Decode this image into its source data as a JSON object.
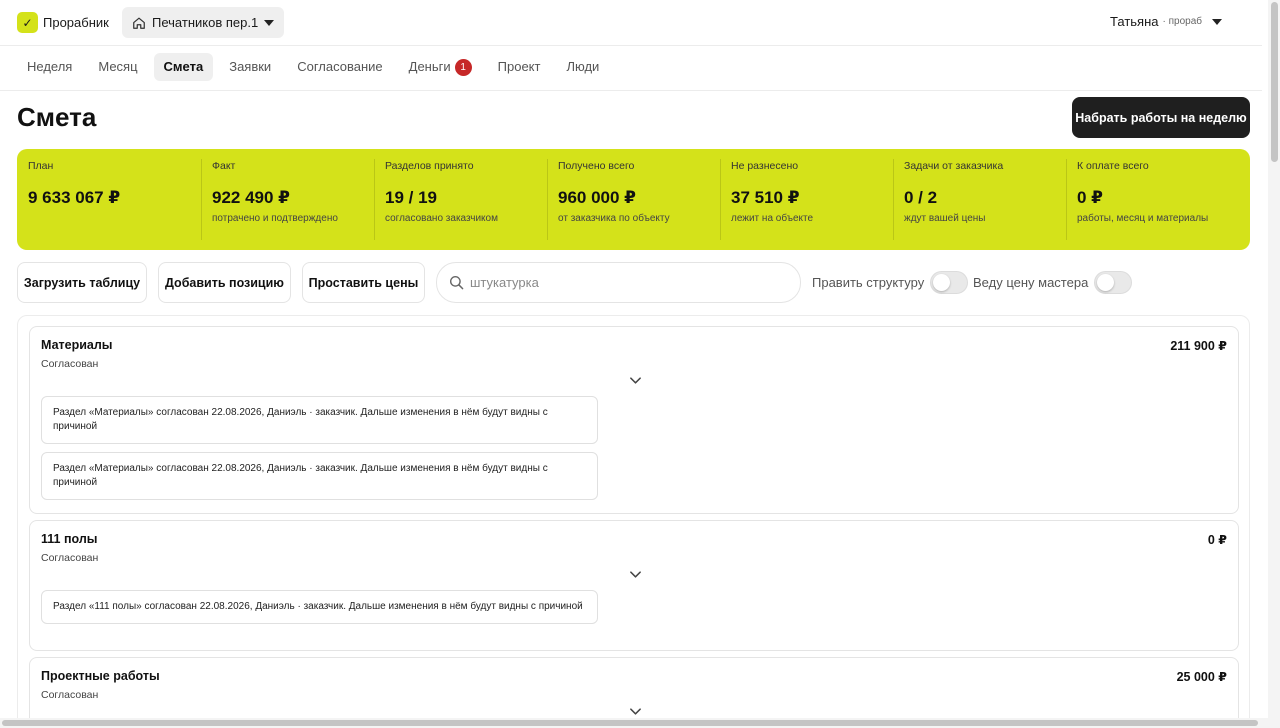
{
  "app": {
    "logo_text": "Прорабник",
    "logo_glyph": "✓"
  },
  "project": {
    "name": "Печатников пер.1"
  },
  "user": {
    "name": "Татьяна",
    "role": "· прораб"
  },
  "tabs": [
    {
      "label": "Неделя"
    },
    {
      "label": "Месяц"
    },
    {
      "label": "Смета"
    },
    {
      "label": "Заявки"
    },
    {
      "label": "Согласование"
    },
    {
      "label": "Деньги",
      "badge": "1"
    },
    {
      "label": "Проект"
    },
    {
      "label": "Люди"
    }
  ],
  "page": {
    "title": "Смета",
    "cta_label": "Набрать работы на неделю"
  },
  "stats": [
    {
      "label": "План",
      "value": "9 633 067 ₽",
      "sub": ""
    },
    {
      "label": "Факт",
      "value": "922 490 ₽",
      "sub": "потрачено и подтверждено"
    },
    {
      "label": "Разделов принято",
      "value": "19 / 19",
      "sub": "согласовано заказчиком"
    },
    {
      "label": "Получено всего",
      "value": "960 000 ₽",
      "sub": "от заказчика по объекту"
    },
    {
      "label": "Не разнесено",
      "value": "37 510 ₽",
      "sub": "лежит на объекте"
    },
    {
      "label": "Задачи от заказчика",
      "value": "0 / 2",
      "sub": "ждут вашей цены"
    },
    {
      "label": "К оплате всего",
      "value": "0 ₽",
      "sub": "работы, месяц и материалы"
    }
  ],
  "toolbar": {
    "upload_label": "Загрузить таблицу",
    "add_label": "Добавить позицию",
    "prices_label": "Проставить цены",
    "search_placeholder": "штукатурка",
    "toggle_structure_label": "Править структуру",
    "toggle_master_label": "Веду цену мастера"
  },
  "sections": [
    {
      "title": "Материалы",
      "status": "Согласован",
      "amount": "211 900 ₽",
      "notes": [
        "Раздел «Материалы» согласован 22.08.2026, Даниэль · заказчик. Дальше изменения в нём будут видны с причиной",
        "Раздел «Материалы» согласован 22.08.2026, Даниэль · заказчик. Дальше изменения в нём будут видны с причиной"
      ]
    },
    {
      "title": "111 полы",
      "status": "Согласован",
      "amount": "0 ₽",
      "notes": [
        "Раздел «111 полы» согласован 22.08.2026, Даниэль · заказчик. Дальше изменения в нём будут видны с причиной"
      ]
    },
    {
      "title": "Проектные работы",
      "status": "Согласован",
      "amount": "25 000 ₽",
      "notes": []
    }
  ],
  "colors": {
    "accent": "#d4e21a",
    "cta": "#1f1f1f",
    "badge": "#c62828"
  }
}
